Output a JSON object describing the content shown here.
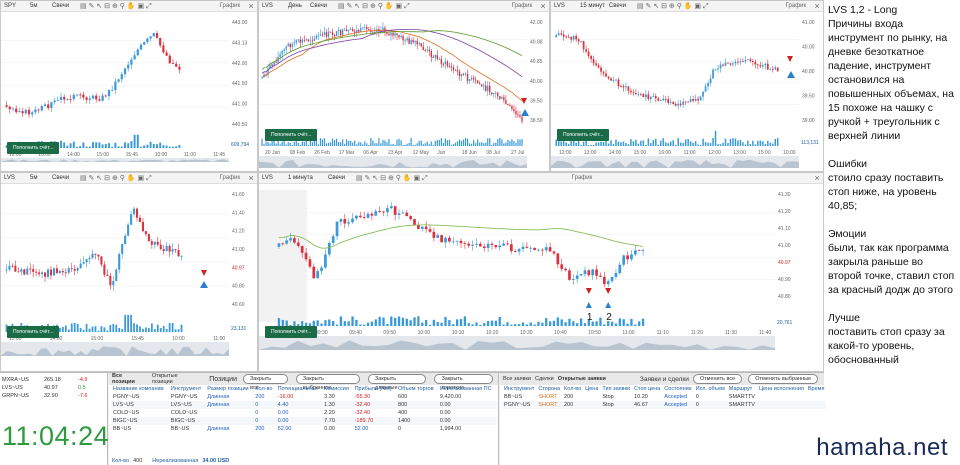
{
  "charts": {
    "tl": {
      "symbol": "SPY",
      "timeframe": "5м",
      "chart_type": "Свечи",
      "title": "График",
      "price_labels": [
        "443.00",
        "443.13",
        "442.00",
        "441.50",
        "441.00",
        "440.50"
      ],
      "time_labels": [
        "12:00",
        "13:00",
        "14:00",
        "15:00",
        "15:45",
        "10:00",
        "11:00",
        "11:45"
      ],
      "volume_label": "609,794",
      "account_button": "Пополнить счёт..."
    },
    "tm": {
      "symbol": "LVS",
      "timeframe": "День",
      "chart_type": "Свечи",
      "title": "График",
      "price_labels": [
        "42.00",
        "40.88",
        "40.85",
        "40.00",
        "39.50",
        "38.50"
      ],
      "time_labels": [
        "20 Jan",
        "08 Feb",
        "26 Feb",
        "17 Mar",
        "06 Apr",
        "23 Apr",
        "12 May",
        "Jun",
        "18 Jun",
        "08 Jul",
        "27 Jul"
      ],
      "account_button": "Пополнить счёт..."
    },
    "tr": {
      "symbol": "LVS",
      "timeframe": "15 минут",
      "chart_type": "Свечи",
      "title": "График",
      "price_labels": [
        "41.00",
        "40.00",
        "40.80",
        "39.50",
        "39.00"
      ],
      "time_labels": [
        "12:00",
        "13:00",
        "14:00",
        "15:00",
        "16:00",
        "11:00",
        "12:00",
        "13:00",
        "15:00",
        "10:00"
      ],
      "volume_label": "113,131",
      "account_button": "Пополнить счёт..."
    },
    "ml": {
      "symbol": "LVS",
      "timeframe": "5м",
      "chart_type": "Свечи",
      "title": "График",
      "price_labels": [
        "41.60",
        "41.40",
        "41.20",
        "41.00",
        "40.97",
        "40.80",
        "40.60"
      ],
      "time_labels": [
        "13:00",
        "14:00",
        "15:00",
        "15:45",
        "10:00",
        "11:00"
      ],
      "volume_labels": [
        "500,000",
        "23,131"
      ],
      "account_button": "Пополнить счёт..."
    },
    "mc": {
      "symbol": "LVS",
      "timeframe": "1 минута",
      "chart_type": "Свечи",
      "title": "График",
      "price_labels": [
        "41.30",
        "41.20",
        "41.10",
        "41.00",
        "40.97",
        "40.90",
        "40.80"
      ],
      "time_labels": [
        "09:20",
        "09:30",
        "09:40",
        "09:50",
        "10:00",
        "10:10",
        "10:20",
        "10:30",
        "10:40",
        "10:50",
        "11:00",
        "11:10",
        "11:20",
        "11:30",
        "11:40"
      ],
      "volume_label": "20,761",
      "annotations": [
        "1",
        "2"
      ],
      "account_button": "Пополнить счёт..."
    }
  },
  "notes": [
    "LVS 1,2 - Long",
    "Причины входа инструмент по рынку, на дневке безоткатное падение, инструмент остановился на повышенных объемах, на 15 похоже на чашку с ручкой + треугольник с верхней линии",
    "Ошибки",
    "стоило сразу поставить стоп ниже, на уровень 40,85;",
    "Эмоции",
    "были, так как программа закрыла раньше во второй точке, ставил стоп за красный додж до этого",
    "Лучше",
    "поставить стоп сразу за какой-то уровень, обоснованный"
  ],
  "watchlist": [
    {
      "sym": "MXRA~US",
      "price": "265.18",
      "chg": "-4.9"
    },
    {
      "sym": "LVS~US",
      "price": "40.97",
      "chg": "0.5"
    },
    {
      "sym": "GRPN~US",
      "price": "32.90",
      "chg": "-7.6"
    }
  ],
  "clock": "11:04:24",
  "positions": {
    "tabs": [
      "Все позиции",
      "Открытые позиции"
    ],
    "title": "Позиции",
    "buttons": [
      "Закрыть все",
      "Закрыть выбранное",
      "Закрыть длинные",
      "Закрыть короткие"
    ],
    "headers": [
      "Название компании",
      "Инструмент",
      "Размер позиции",
      "Кол-во",
      "Потенциальная",
      "Комиссия",
      "Прибыль (Net)",
      "Объем торгов",
      "Использованная ПС"
    ],
    "rows": [
      [
        "PGNY~US",
        "PGNY~US",
        "Длинная",
        "200",
        "-16.00",
        "3.30",
        "-55.30",
        "600",
        "9,420.00"
      ],
      [
        "LVS~US",
        "LVS~US",
        "Длинная",
        "0",
        "4.40",
        "1.30",
        "-32.40",
        "800",
        "0.00"
      ],
      [
        "COLD~US",
        "COLD~US",
        "",
        "0",
        "0.00",
        "2.20",
        "-32.40",
        "400",
        "0.00"
      ],
      [
        "BIGC~US",
        "BIGC~US",
        "",
        "0",
        "0.00",
        "7.70",
        "-189.70",
        "1400",
        "0.00"
      ],
      [
        "BB~US",
        "BB~US",
        "Длинная",
        "200",
        "52.00",
        "0.00",
        "52.00",
        "0",
        "1,994.00"
      ]
    ],
    "footer_qty_label": "Кол-во",
    "footer_qty": "400",
    "footer_pnl_label": "Нереализованная",
    "footer_pnl": "34.00 USD"
  },
  "orders": {
    "tabs": [
      "Все заявки",
      "Сделки",
      "Открытые заявки"
    ],
    "title": "Заявки и сделки",
    "buttons": [
      "Отменить все",
      "Отменить выбранные"
    ],
    "headers": [
      "Инструмент",
      "Сторона",
      "Кол-во",
      "Цена",
      "Тип заявки",
      "Стоп цена",
      "Состояние",
      "Исп. объем",
      "Маршрут",
      "Цена исполнения",
      "Время"
    ],
    "rows": [
      [
        "BB~US",
        "SHORT",
        "200",
        "",
        "Stop",
        "10.20",
        "Accepted",
        "0",
        "SMARTTV",
        "",
        ""
      ],
      [
        "PGNY~US",
        "SHORT",
        "200",
        "",
        "Stop",
        "46.67",
        "Accepted",
        "0",
        "SMARTTV",
        "",
        ""
      ]
    ]
  },
  "watermark": "hamaha.net",
  "colors": {
    "up": "#3a9ad9",
    "down": "#d9333f",
    "volume": "#3a9ad9",
    "green_btn": "#1b6b47",
    "clock": "#2f9a3e"
  }
}
